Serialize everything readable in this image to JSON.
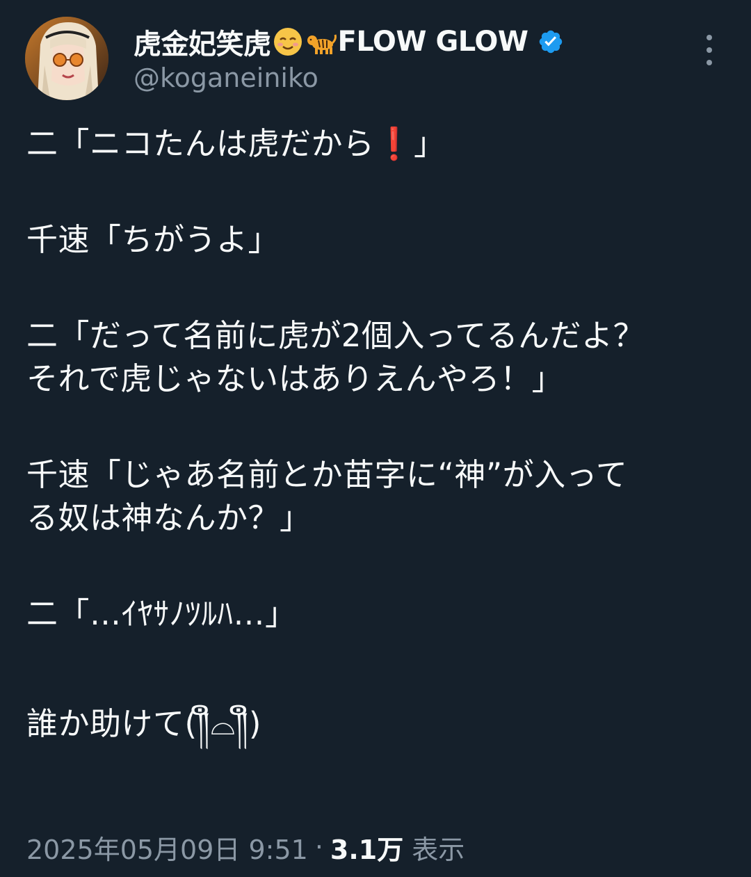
{
  "author": {
    "display_name": "虎金妃笑虎",
    "name_suffix": "FLOW GLOW",
    "handle": "@koganeiniko",
    "emojis": [
      "relieved-face-emoji",
      "tiger-emoji"
    ],
    "verified_color": "#1d9bf0"
  },
  "tweet": {
    "lines": [
      "二「ニコたんは虎だから❗」",
      "",
      "千速「ちがうよ」",
      "",
      "二「だって名前に虎が2個入ってるんだよ？",
      "それで虎じゃないはありえんやろ！」",
      "",
      "千速「じゃあ名前とか苗字に“神”が入って",
      "る奴は神なんか？」",
      "",
      "二「…ｲﾔｻﾉﾂﾙﾊ…」",
      "",
      "誰か助けて(༎ຶ⌓༎ຶ)"
    ]
  },
  "meta": {
    "timestamp": "2025年05月09日 9:51",
    "separator": "·",
    "views_count": "3.1万",
    "views_label": "表示"
  },
  "colors": {
    "background": "#15202b",
    "text": "#f7f9f9",
    "secondary": "#8b98a5",
    "accent": "#1d9bf0"
  }
}
